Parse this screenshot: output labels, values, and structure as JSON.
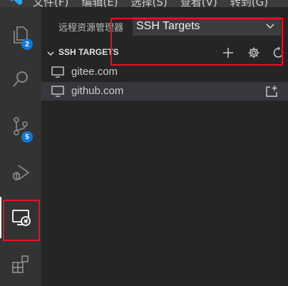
{
  "menubar": {
    "items": [
      "文件(F)",
      "编辑(E)",
      "选择(S)",
      "查看(V)",
      "转到(G)"
    ]
  },
  "activitybar": {
    "explorer_badge": "2",
    "scm_badge": "5"
  },
  "sidebar": {
    "header_label": "远程资源管理器",
    "target_select": "SSH Targets",
    "section_title": "SSH TARGETS",
    "hosts": [
      {
        "name": "gitee.com"
      },
      {
        "name": "github.com"
      }
    ]
  },
  "colors": {
    "activity_bg": "#333333",
    "sidebar_bg": "#252526",
    "badge": "#1177d4",
    "highlight_box": "#e81123",
    "selected_row": "#37373d"
  }
}
